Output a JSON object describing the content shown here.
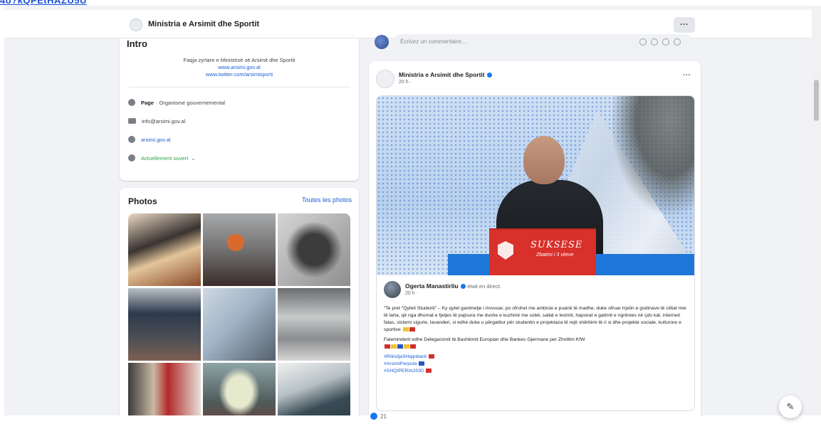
{
  "top_link": "4o?kQPEtHAZU5U",
  "page": {
    "name": "Ministria e Arsimit dhe Sportit",
    "more_label": "···"
  },
  "intro": {
    "title": "Intro",
    "description": "Faqja zyrtare e Ministrisë së Arsimit dhe Sportit",
    "website_link": "www.arsimi.gov.al",
    "twitter_link": "www.twitter.com/arsimisporti",
    "category_label": "Page",
    "category_value": "· Organisme gouvernemental",
    "email": "info@arsimi.gov.al",
    "website": "arsimi.gov.al",
    "status": "Actuellement ouvert"
  },
  "photos": {
    "title": "Photos",
    "see_all": "Toutes les photos"
  },
  "comment": {
    "placeholder": "Écrivez un commentaire…"
  },
  "post": {
    "author": "Ministria e Arsimit dhe Sportit",
    "time": "20 h ·",
    "more_label": "···",
    "image_podium_text": "SUKSESE",
    "image_podium_sub": "Zbatimi i 3 viteve",
    "shared": {
      "author": "Ogerta Manastirliu",
      "live": "était en direct.",
      "time": "20 h ·",
      "body": "“Te pret “Qyteti Studenti” – Ky qytet ganimetje i rinovuar, po ofrohet me ambicie e puanë të madhe, duke ofruar rrjetin e godinave të cilitat mei të larta, që nga dhomat e fjetjes të pajisura me dushe e kuzhinë me sobë, sallat e leximit, hapsirat e gatimit e ngrënies në çdo kat, interneti falas, sistemi sigurie, lavanderi, si edhe duke u përgatitur për studentin e projektaza të rejë shërbimi të ri si dhe projekte sociale, kulturore e sportive",
      "thanks": "Faleminderit edhe Delegacionit të Bashkimit Europian dhe Bankes Gjermane per Zhvillim KfW",
      "tags": [
        "#RilindjaSHqipëtarë",
        "#ArsimiPerputa",
        "#SHQIPERIA2030"
      ]
    },
    "likes_count": "21"
  }
}
